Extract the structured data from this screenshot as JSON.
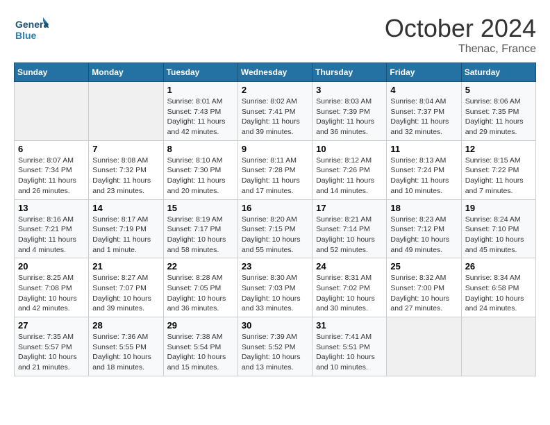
{
  "header": {
    "logo_line1": "General",
    "logo_line2": "Blue",
    "month": "October 2024",
    "location": "Thenac, France"
  },
  "days_of_week": [
    "Sunday",
    "Monday",
    "Tuesday",
    "Wednesday",
    "Thursday",
    "Friday",
    "Saturday"
  ],
  "weeks": [
    [
      {
        "day": "",
        "sunrise": "",
        "sunset": "",
        "daylight": ""
      },
      {
        "day": "",
        "sunrise": "",
        "sunset": "",
        "daylight": ""
      },
      {
        "day": "1",
        "sunrise": "Sunrise: 8:01 AM",
        "sunset": "Sunset: 7:43 PM",
        "daylight": "Daylight: 11 hours and 42 minutes."
      },
      {
        "day": "2",
        "sunrise": "Sunrise: 8:02 AM",
        "sunset": "Sunset: 7:41 PM",
        "daylight": "Daylight: 11 hours and 39 minutes."
      },
      {
        "day": "3",
        "sunrise": "Sunrise: 8:03 AM",
        "sunset": "Sunset: 7:39 PM",
        "daylight": "Daylight: 11 hours and 36 minutes."
      },
      {
        "day": "4",
        "sunrise": "Sunrise: 8:04 AM",
        "sunset": "Sunset: 7:37 PM",
        "daylight": "Daylight: 11 hours and 32 minutes."
      },
      {
        "day": "5",
        "sunrise": "Sunrise: 8:06 AM",
        "sunset": "Sunset: 7:35 PM",
        "daylight": "Daylight: 11 hours and 29 minutes."
      }
    ],
    [
      {
        "day": "6",
        "sunrise": "Sunrise: 8:07 AM",
        "sunset": "Sunset: 7:34 PM",
        "daylight": "Daylight: 11 hours and 26 minutes."
      },
      {
        "day": "7",
        "sunrise": "Sunrise: 8:08 AM",
        "sunset": "Sunset: 7:32 PM",
        "daylight": "Daylight: 11 hours and 23 minutes."
      },
      {
        "day": "8",
        "sunrise": "Sunrise: 8:10 AM",
        "sunset": "Sunset: 7:30 PM",
        "daylight": "Daylight: 11 hours and 20 minutes."
      },
      {
        "day": "9",
        "sunrise": "Sunrise: 8:11 AM",
        "sunset": "Sunset: 7:28 PM",
        "daylight": "Daylight: 11 hours and 17 minutes."
      },
      {
        "day": "10",
        "sunrise": "Sunrise: 8:12 AM",
        "sunset": "Sunset: 7:26 PM",
        "daylight": "Daylight: 11 hours and 14 minutes."
      },
      {
        "day": "11",
        "sunrise": "Sunrise: 8:13 AM",
        "sunset": "Sunset: 7:24 PM",
        "daylight": "Daylight: 11 hours and 10 minutes."
      },
      {
        "day": "12",
        "sunrise": "Sunrise: 8:15 AM",
        "sunset": "Sunset: 7:22 PM",
        "daylight": "Daylight: 11 hours and 7 minutes."
      }
    ],
    [
      {
        "day": "13",
        "sunrise": "Sunrise: 8:16 AM",
        "sunset": "Sunset: 7:21 PM",
        "daylight": "Daylight: 11 hours and 4 minutes."
      },
      {
        "day": "14",
        "sunrise": "Sunrise: 8:17 AM",
        "sunset": "Sunset: 7:19 PM",
        "daylight": "Daylight: 11 hours and 1 minute."
      },
      {
        "day": "15",
        "sunrise": "Sunrise: 8:19 AM",
        "sunset": "Sunset: 7:17 PM",
        "daylight": "Daylight: 10 hours and 58 minutes."
      },
      {
        "day": "16",
        "sunrise": "Sunrise: 8:20 AM",
        "sunset": "Sunset: 7:15 PM",
        "daylight": "Daylight: 10 hours and 55 minutes."
      },
      {
        "day": "17",
        "sunrise": "Sunrise: 8:21 AM",
        "sunset": "Sunset: 7:14 PM",
        "daylight": "Daylight: 10 hours and 52 minutes."
      },
      {
        "day": "18",
        "sunrise": "Sunrise: 8:23 AM",
        "sunset": "Sunset: 7:12 PM",
        "daylight": "Daylight: 10 hours and 49 minutes."
      },
      {
        "day": "19",
        "sunrise": "Sunrise: 8:24 AM",
        "sunset": "Sunset: 7:10 PM",
        "daylight": "Daylight: 10 hours and 45 minutes."
      }
    ],
    [
      {
        "day": "20",
        "sunrise": "Sunrise: 8:25 AM",
        "sunset": "Sunset: 7:08 PM",
        "daylight": "Daylight: 10 hours and 42 minutes."
      },
      {
        "day": "21",
        "sunrise": "Sunrise: 8:27 AM",
        "sunset": "Sunset: 7:07 PM",
        "daylight": "Daylight: 10 hours and 39 minutes."
      },
      {
        "day": "22",
        "sunrise": "Sunrise: 8:28 AM",
        "sunset": "Sunset: 7:05 PM",
        "daylight": "Daylight: 10 hours and 36 minutes."
      },
      {
        "day": "23",
        "sunrise": "Sunrise: 8:30 AM",
        "sunset": "Sunset: 7:03 PM",
        "daylight": "Daylight: 10 hours and 33 minutes."
      },
      {
        "day": "24",
        "sunrise": "Sunrise: 8:31 AM",
        "sunset": "Sunset: 7:02 PM",
        "daylight": "Daylight: 10 hours and 30 minutes."
      },
      {
        "day": "25",
        "sunrise": "Sunrise: 8:32 AM",
        "sunset": "Sunset: 7:00 PM",
        "daylight": "Daylight: 10 hours and 27 minutes."
      },
      {
        "day": "26",
        "sunrise": "Sunrise: 8:34 AM",
        "sunset": "Sunset: 6:58 PM",
        "daylight": "Daylight: 10 hours and 24 minutes."
      }
    ],
    [
      {
        "day": "27",
        "sunrise": "Sunrise: 7:35 AM",
        "sunset": "Sunset: 5:57 PM",
        "daylight": "Daylight: 10 hours and 21 minutes."
      },
      {
        "day": "28",
        "sunrise": "Sunrise: 7:36 AM",
        "sunset": "Sunset: 5:55 PM",
        "daylight": "Daylight: 10 hours and 18 minutes."
      },
      {
        "day": "29",
        "sunrise": "Sunrise: 7:38 AM",
        "sunset": "Sunset: 5:54 PM",
        "daylight": "Daylight: 10 hours and 15 minutes."
      },
      {
        "day": "30",
        "sunrise": "Sunrise: 7:39 AM",
        "sunset": "Sunset: 5:52 PM",
        "daylight": "Daylight: 10 hours and 13 minutes."
      },
      {
        "day": "31",
        "sunrise": "Sunrise: 7:41 AM",
        "sunset": "Sunset: 5:51 PM",
        "daylight": "Daylight: 10 hours and 10 minutes."
      },
      {
        "day": "",
        "sunrise": "",
        "sunset": "",
        "daylight": ""
      },
      {
        "day": "",
        "sunrise": "",
        "sunset": "",
        "daylight": ""
      }
    ]
  ]
}
